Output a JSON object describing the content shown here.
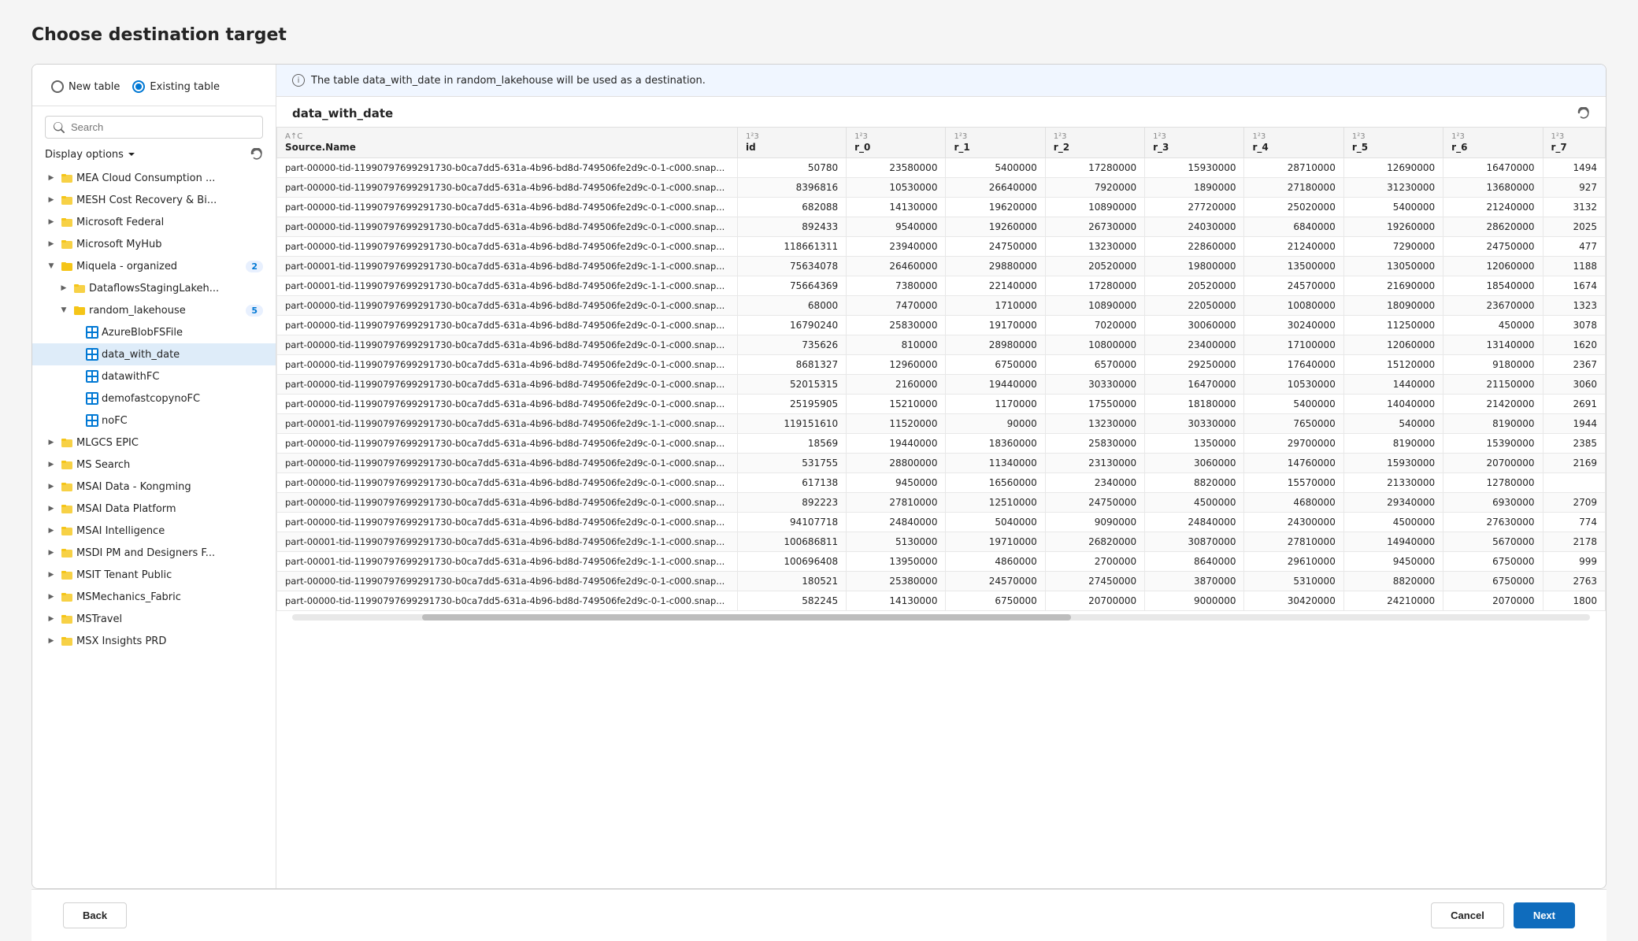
{
  "page": {
    "title": "Choose destination target"
  },
  "radio": {
    "options": [
      {
        "id": "new-table",
        "label": "New table",
        "selected": false
      },
      {
        "id": "existing-table",
        "label": "Existing table",
        "selected": true
      }
    ]
  },
  "search": {
    "placeholder": "Search"
  },
  "display_options": {
    "label": "Display options"
  },
  "info_banner": {
    "text": "The table data_with_date in random_lakehouse will be used as a destination."
  },
  "table_name": "data_with_date",
  "columns": [
    {
      "type": "A↑C",
      "name": "Source.Name"
    },
    {
      "type": "1²3",
      "name": "id"
    },
    {
      "type": "1²3",
      "name": "r_0"
    },
    {
      "type": "1²3",
      "name": "r_1"
    },
    {
      "type": "1²3",
      "name": "r_2"
    },
    {
      "type": "1²3",
      "name": "r_3"
    },
    {
      "type": "1²3",
      "name": "r_4"
    },
    {
      "type": "1²3",
      "name": "r_5"
    },
    {
      "type": "1²3",
      "name": "r_6"
    },
    {
      "type": "1²3",
      "name": "r_7"
    }
  ],
  "rows": [
    {
      "source": "part-00000-tid-11990797699291730-b0ca7dd5-631a-4b96-bd8d-749506fe2d9c-0-1-c000.snap...",
      "id": "50780",
      "r0": "23580000",
      "r1": "5400000",
      "r2": "17280000",
      "r3": "15930000",
      "r4": "28710000",
      "r5": "12690000",
      "r6": "16470000",
      "r7": "1494"
    },
    {
      "source": "part-00000-tid-11990797699291730-b0ca7dd5-631a-4b96-bd8d-749506fe2d9c-0-1-c000.snap...",
      "id": "8396816",
      "r0": "10530000",
      "r1": "26640000",
      "r2": "7920000",
      "r3": "1890000",
      "r4": "27180000",
      "r5": "31230000",
      "r6": "13680000",
      "r7": "927"
    },
    {
      "source": "part-00000-tid-11990797699291730-b0ca7dd5-631a-4b96-bd8d-749506fe2d9c-0-1-c000.snap...",
      "id": "682088",
      "r0": "14130000",
      "r1": "19620000",
      "r2": "10890000",
      "r3": "27720000",
      "r4": "25020000",
      "r5": "5400000",
      "r6": "21240000",
      "r7": "3132"
    },
    {
      "source": "part-00000-tid-11990797699291730-b0ca7dd5-631a-4b96-bd8d-749506fe2d9c-0-1-c000.snap...",
      "id": "892433",
      "r0": "9540000",
      "r1": "19260000",
      "r2": "26730000",
      "r3": "24030000",
      "r4": "6840000",
      "r5": "19260000",
      "r6": "28620000",
      "r7": "2025"
    },
    {
      "source": "part-00000-tid-11990797699291730-b0ca7dd5-631a-4b96-bd8d-749506fe2d9c-0-1-c000.snap...",
      "id": "118661311",
      "r0": "23940000",
      "r1": "24750000",
      "r2": "13230000",
      "r3": "22860000",
      "r4": "21240000",
      "r5": "7290000",
      "r6": "24750000",
      "r7": "477"
    },
    {
      "source": "part-00001-tid-11990797699291730-b0ca7dd5-631a-4b96-bd8d-749506fe2d9c-1-1-c000.snap...",
      "id": "75634078",
      "r0": "26460000",
      "r1": "29880000",
      "r2": "20520000",
      "r3": "19800000",
      "r4": "13500000",
      "r5": "13050000",
      "r6": "12060000",
      "r7": "1188"
    },
    {
      "source": "part-00001-tid-11990797699291730-b0ca7dd5-631a-4b96-bd8d-749506fe2d9c-1-1-c000.snap...",
      "id": "75664369",
      "r0": "7380000",
      "r1": "22140000",
      "r2": "17280000",
      "r3": "20520000",
      "r4": "24570000",
      "r5": "21690000",
      "r6": "18540000",
      "r7": "1674"
    },
    {
      "source": "part-00000-tid-11990797699291730-b0ca7dd5-631a-4b96-bd8d-749506fe2d9c-0-1-c000.snap...",
      "id": "68000",
      "r0": "7470000",
      "r1": "1710000",
      "r2": "10890000",
      "r3": "22050000",
      "r4": "10080000",
      "r5": "18090000",
      "r6": "23670000",
      "r7": "1323"
    },
    {
      "source": "part-00000-tid-11990797699291730-b0ca7dd5-631a-4b96-bd8d-749506fe2d9c-0-1-c000.snap...",
      "id": "16790240",
      "r0": "25830000",
      "r1": "19170000",
      "r2": "7020000",
      "r3": "30060000",
      "r4": "30240000",
      "r5": "11250000",
      "r6": "450000",
      "r7": "3078"
    },
    {
      "source": "part-00000-tid-11990797699291730-b0ca7dd5-631a-4b96-bd8d-749506fe2d9c-0-1-c000.snap...",
      "id": "735626",
      "r0": "810000",
      "r1": "28980000",
      "r2": "10800000",
      "r3": "23400000",
      "r4": "17100000",
      "r5": "12060000",
      "r6": "13140000",
      "r7": "1620"
    },
    {
      "source": "part-00000-tid-11990797699291730-b0ca7dd5-631a-4b96-bd8d-749506fe2d9c-0-1-c000.snap...",
      "id": "8681327",
      "r0": "12960000",
      "r1": "6750000",
      "r2": "6570000",
      "r3": "29250000",
      "r4": "17640000",
      "r5": "15120000",
      "r6": "9180000",
      "r7": "2367"
    },
    {
      "source": "part-00000-tid-11990797699291730-b0ca7dd5-631a-4b96-bd8d-749506fe2d9c-0-1-c000.snap...",
      "id": "52015315",
      "r0": "2160000",
      "r1": "19440000",
      "r2": "30330000",
      "r3": "16470000",
      "r4": "10530000",
      "r5": "1440000",
      "r6": "21150000",
      "r7": "3060"
    },
    {
      "source": "part-00000-tid-11990797699291730-b0ca7dd5-631a-4b96-bd8d-749506fe2d9c-0-1-c000.snap...",
      "id": "25195905",
      "r0": "15210000",
      "r1": "1170000",
      "r2": "17550000",
      "r3": "18180000",
      "r4": "5400000",
      "r5": "14040000",
      "r6": "21420000",
      "r7": "2691"
    },
    {
      "source": "part-00001-tid-11990797699291730-b0ca7dd5-631a-4b96-bd8d-749506fe2d9c-1-1-c000.snap...",
      "id": "119151610",
      "r0": "11520000",
      "r1": "90000",
      "r2": "13230000",
      "r3": "30330000",
      "r4": "7650000",
      "r5": "540000",
      "r6": "8190000",
      "r7": "1944"
    },
    {
      "source": "part-00000-tid-11990797699291730-b0ca7dd5-631a-4b96-bd8d-749506fe2d9c-0-1-c000.snap...",
      "id": "18569",
      "r0": "19440000",
      "r1": "18360000",
      "r2": "25830000",
      "r3": "1350000",
      "r4": "29700000",
      "r5": "8190000",
      "r6": "15390000",
      "r7": "2385"
    },
    {
      "source": "part-00000-tid-11990797699291730-b0ca7dd5-631a-4b96-bd8d-749506fe2d9c-0-1-c000.snap...",
      "id": "531755",
      "r0": "28800000",
      "r1": "11340000",
      "r2": "23130000",
      "r3": "3060000",
      "r4": "14760000",
      "r5": "15930000",
      "r6": "20700000",
      "r7": "2169"
    },
    {
      "source": "part-00000-tid-11990797699291730-b0ca7dd5-631a-4b96-bd8d-749506fe2d9c-0-1-c000.snap...",
      "id": "617138",
      "r0": "9450000",
      "r1": "16560000",
      "r2": "2340000",
      "r3": "8820000",
      "r4": "15570000",
      "r5": "21330000",
      "r6": "12780000",
      "r7": ""
    },
    {
      "source": "part-00000-tid-11990797699291730-b0ca7dd5-631a-4b96-bd8d-749506fe2d9c-0-1-c000.snap...",
      "id": "892223",
      "r0": "27810000",
      "r1": "12510000",
      "r2": "24750000",
      "r3": "4500000",
      "r4": "4680000",
      "r5": "29340000",
      "r6": "6930000",
      "r7": "2709"
    },
    {
      "source": "part-00000-tid-11990797699291730-b0ca7dd5-631a-4b96-bd8d-749506fe2d9c-0-1-c000.snap...",
      "id": "94107718",
      "r0": "24840000",
      "r1": "5040000",
      "r2": "9090000",
      "r3": "24840000",
      "r4": "24300000",
      "r5": "4500000",
      "r6": "27630000",
      "r7": "774"
    },
    {
      "source": "part-00001-tid-11990797699291730-b0ca7dd5-631a-4b96-bd8d-749506fe2d9c-1-1-c000.snap...",
      "id": "100686811",
      "r0": "5130000",
      "r1": "19710000",
      "r2": "26820000",
      "r3": "30870000",
      "r4": "27810000",
      "r5": "14940000",
      "r6": "5670000",
      "r7": "2178"
    },
    {
      "source": "part-00001-tid-11990797699291730-b0ca7dd5-631a-4b96-bd8d-749506fe2d9c-1-1-c000.snap...",
      "id": "100696408",
      "r0": "13950000",
      "r1": "4860000",
      "r2": "2700000",
      "r3": "8640000",
      "r4": "29610000",
      "r5": "9450000",
      "r6": "6750000",
      "r7": "999"
    },
    {
      "source": "part-00000-tid-11990797699291730-b0ca7dd5-631a-4b96-bd8d-749506fe2d9c-0-1-c000.snap...",
      "id": "180521",
      "r0": "25380000",
      "r1": "24570000",
      "r2": "27450000",
      "r3": "3870000",
      "r4": "5310000",
      "r5": "8820000",
      "r6": "6750000",
      "r7": "2763"
    },
    {
      "source": "part-00000-tid-11990797699291730-b0ca7dd5-631a-4b96-bd8d-749506fe2d9c-0-1-c000.snap...",
      "id": "582245",
      "r0": "14130000",
      "r1": "6750000",
      "r2": "20700000",
      "r3": "9000000",
      "r4": "30420000",
      "r5": "24210000",
      "r6": "2070000",
      "r7": "1800"
    }
  ],
  "tree": {
    "items": [
      {
        "indent": 1,
        "chevron": "collapsed",
        "icon": "folder",
        "label": "MEA Cloud Consumption ...",
        "badge": ""
      },
      {
        "indent": 1,
        "chevron": "collapsed",
        "icon": "folder",
        "label": "MESH Cost Recovery & Bi...",
        "badge": ""
      },
      {
        "indent": 1,
        "chevron": "collapsed",
        "icon": "folder",
        "label": "Microsoft Federal",
        "badge": ""
      },
      {
        "indent": 1,
        "chevron": "collapsed",
        "icon": "folder",
        "label": "Microsoft MyHub",
        "badge": ""
      },
      {
        "indent": 1,
        "chevron": "expanded",
        "icon": "folder",
        "label": "Miquela - organized",
        "badge": "2"
      },
      {
        "indent": 2,
        "chevron": "collapsed",
        "icon": "folder",
        "label": "DataflowsStagingLakeh...",
        "badge": ""
      },
      {
        "indent": 2,
        "chevron": "expanded",
        "icon": "folder",
        "label": "random_lakehouse",
        "badge": "5"
      },
      {
        "indent": 3,
        "chevron": "none",
        "icon": "table",
        "label": "AzureBlobFSFile",
        "badge": ""
      },
      {
        "indent": 3,
        "chevron": "none",
        "icon": "table",
        "label": "data_with_date",
        "badge": "",
        "selected": true
      },
      {
        "indent": 3,
        "chevron": "none",
        "icon": "table",
        "label": "datawithFC",
        "badge": ""
      },
      {
        "indent": 3,
        "chevron": "none",
        "icon": "table",
        "label": "demofastcopynoFC",
        "badge": ""
      },
      {
        "indent": 3,
        "chevron": "none",
        "icon": "table",
        "label": "noFC",
        "badge": ""
      },
      {
        "indent": 1,
        "chevron": "collapsed",
        "icon": "folder",
        "label": "MLGCS EPIC",
        "badge": ""
      },
      {
        "indent": 1,
        "chevron": "collapsed",
        "icon": "folder",
        "label": "MS Search",
        "badge": ""
      },
      {
        "indent": 1,
        "chevron": "collapsed",
        "icon": "folder",
        "label": "MSAI Data - Kongming",
        "badge": ""
      },
      {
        "indent": 1,
        "chevron": "collapsed",
        "icon": "folder",
        "label": "MSAI Data Platform",
        "badge": ""
      },
      {
        "indent": 1,
        "chevron": "collapsed",
        "icon": "folder",
        "label": "MSAI Intelligence",
        "badge": ""
      },
      {
        "indent": 1,
        "chevron": "collapsed",
        "icon": "folder",
        "label": "MSDI PM and Designers F...",
        "badge": ""
      },
      {
        "indent": 1,
        "chevron": "collapsed",
        "icon": "folder",
        "label": "MSIT Tenant Public",
        "badge": ""
      },
      {
        "indent": 1,
        "chevron": "collapsed",
        "icon": "folder",
        "label": "MSMechanics_Fabric",
        "badge": ""
      },
      {
        "indent": 1,
        "chevron": "collapsed",
        "icon": "folder",
        "label": "MSTravel",
        "badge": ""
      },
      {
        "indent": 1,
        "chevron": "collapsed",
        "icon": "folder",
        "label": "MSX Insights PRD",
        "badge": ""
      }
    ]
  },
  "footer": {
    "back_label": "Back",
    "cancel_label": "Cancel",
    "next_label": "Next"
  }
}
